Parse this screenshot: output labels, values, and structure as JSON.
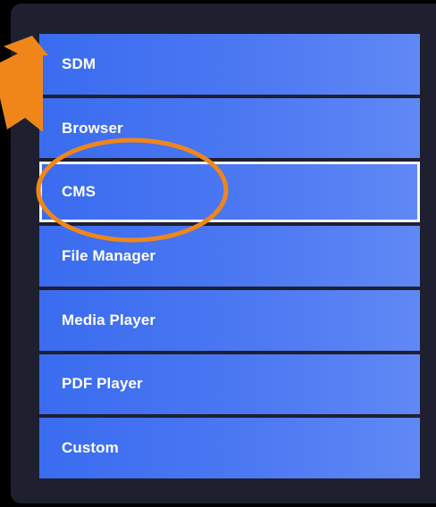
{
  "menu": {
    "items": [
      {
        "label": "SDM",
        "selected": false
      },
      {
        "label": "Browser",
        "selected": false
      },
      {
        "label": "CMS",
        "selected": true
      },
      {
        "label": "File Manager",
        "selected": false
      },
      {
        "label": "Media Player",
        "selected": false
      },
      {
        "label": "PDF Player",
        "selected": false
      },
      {
        "label": "Custom",
        "selected": false
      }
    ]
  },
  "colors": {
    "background": "#000000",
    "panel": "#1e2030",
    "item_start": "#3a6cf0",
    "item_end": "#6088f5",
    "selection_border": "#f3f4f8",
    "annotation": "#f0861a"
  },
  "annotations": {
    "arrow_icon": "arrow-pointer-icon",
    "circle_icon": "highlight-ellipse-icon"
  }
}
